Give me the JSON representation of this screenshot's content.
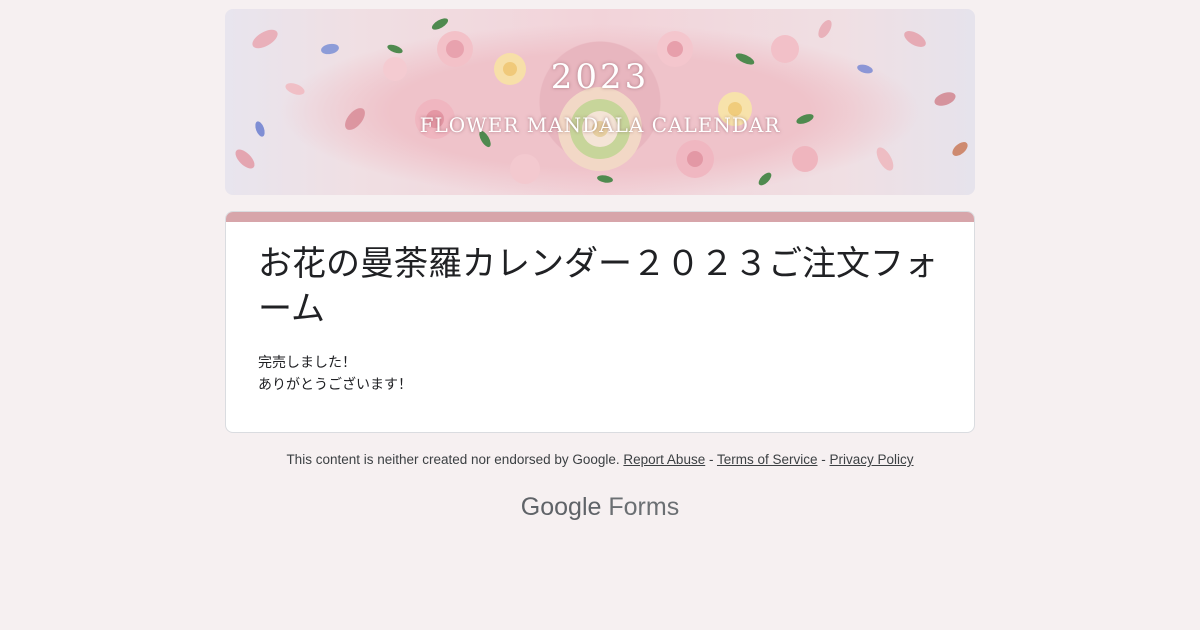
{
  "banner": {
    "year": "2023",
    "caption": "FLOWER MANDALA CALENDAR"
  },
  "form": {
    "title": "お花の曼荼羅カレンダー２０２３ご注文フォーム",
    "description_lines": [
      "完売しました！",
      "ありがとうございます！"
    ]
  },
  "footer": {
    "disclaimer": "This content is neither created nor endorsed by Google.",
    "report_abuse": "Report Abuse",
    "separator": " - ",
    "terms": "Terms of Service",
    "privacy": "Privacy Policy"
  },
  "brand": {
    "google": "Google",
    "product": "Forms"
  },
  "colors": {
    "page_background": "#f6f0f1",
    "card_accent": "#d7a5aa",
    "text": "#202124"
  }
}
